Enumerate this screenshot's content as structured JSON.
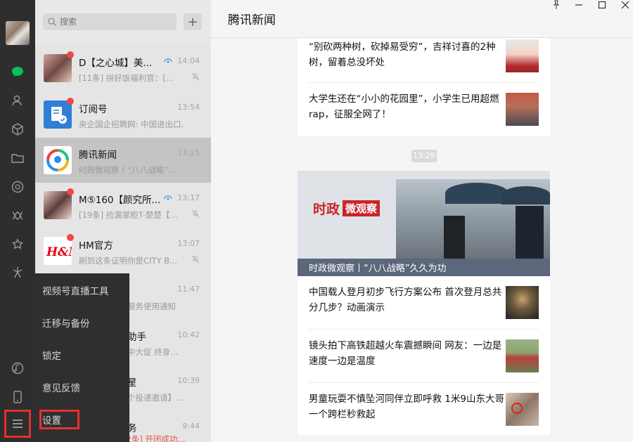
{
  "search": {
    "placeholder": "搜索"
  },
  "chats": [
    {
      "name": "D【之心城】美...",
      "time": "14:04",
      "preview": "[11条] 拼好饭福利官：[..."
    },
    {
      "name": "订阅号",
      "time": "13:54",
      "preview": "央企国企招聘网: 中国进出口..."
    },
    {
      "name": "腾讯新闻",
      "time": "13:25",
      "preview": "时政微观察丨“八八战略”..."
    },
    {
      "name": "M⑤160【颜究所...",
      "time": "13:17",
      "preview": "[19条] 捡漏掌柜T-楚楚【..."
    },
    {
      "name": "HM官方",
      "time": "13:07",
      "preview": "刷到这条证明你是CITY B..."
    },
    {
      "name": "",
      "time": "11:47",
      "preview": "服务使用通知"
    },
    {
      "name": "助手",
      "time": "10:42",
      "preview": "中大促 终身..."
    },
    {
      "name": "星",
      "time": "10:39",
      "preview": "个投递邀请】..."
    },
    {
      "name": "务",
      "time": "9:44",
      "preview": "[服务通知][2条] 开团成功..."
    }
  ],
  "menu": {
    "items": [
      "视频号直播工具",
      "迁移与备份",
      "锁定",
      "意见反馈",
      "设置"
    ]
  },
  "main": {
    "title": "腾讯新闻",
    "top_articles": [
      "“别砍两种树，砍掉易受穷”，吉祥讨喜的2种树，留着总没坏处",
      "大学生还在“小小的花园里”，小学生已用超燃rap，征服全网了！"
    ],
    "time_chip": "13:25",
    "banner": {
      "logo_red": "时政",
      "logo_box": "微观察",
      "caption": "时政微观察丨“八八战略”久久为功"
    },
    "articles": [
      "中国载人登月初步飞行方案公布 首次登月总共分几步？动画演示",
      "镜头拍下高铁超越火车震撼瞬间 网友：一边是速度一边是温度",
      "男童玩耍不慎坠河同伴立即呼救 1米9山东大哥一个跨栏秒救起"
    ]
  },
  "colors": {
    "sidebar": "#2e2e2e",
    "list": "#e6e5e5",
    "accent_red": "#e53030",
    "wechat_green": "#07c160"
  }
}
